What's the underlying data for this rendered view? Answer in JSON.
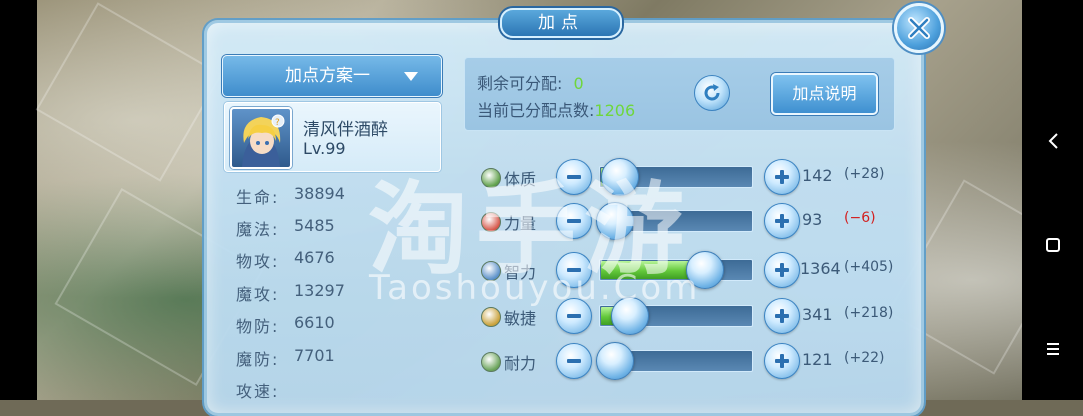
{
  "dialog": {
    "title": "加点",
    "scheme_label": "加点方案一",
    "explain_label": "加点说明"
  },
  "character": {
    "name": "清风伴酒醉",
    "level": "Lv.99"
  },
  "stats": [
    {
      "label": "生命:",
      "value": "38894"
    },
    {
      "label": "魔法:",
      "value": "5485"
    },
    {
      "label": "物攻:",
      "value": "4676"
    },
    {
      "label": "魔攻:",
      "value": "13297"
    },
    {
      "label": "物防:",
      "value": "6610"
    },
    {
      "label": "魔防:",
      "value": "7701"
    },
    {
      "label": "攻速:",
      "value": ""
    }
  ],
  "points": {
    "remaining_label": "剩余可分配:",
    "remaining_value": "0",
    "allocated_label": "当前已分配点数:",
    "allocated_value": "1206"
  },
  "attributes": [
    {
      "name": "体质",
      "value": "142",
      "bonus": "(+28)",
      "fill": 0.03,
      "icon": "constitution-icon",
      "icon_color": "#5fa04a"
    },
    {
      "name": "力量",
      "value": "93",
      "bonus": "(−6)",
      "fill": 0.0,
      "icon": "strength-icon",
      "icon_color": "#d6574a"
    },
    {
      "name": "智力",
      "value": "1364",
      "bonus": "(+405)",
      "fill": 0.6,
      "icon": "intellect-icon",
      "icon_color": "#5a90c9"
    },
    {
      "name": "敏捷",
      "value": "341",
      "bonus": "(+218)",
      "fill": 0.1,
      "icon": "agility-icon",
      "icon_color": "#c9a13a"
    },
    {
      "name": "耐力",
      "value": "121",
      "bonus": "(+22)",
      "fill": 0.0,
      "icon": "endurance-icon",
      "icon_color": "#6aa35a"
    }
  ],
  "watermark": {
    "text": "淘手游",
    "url": "Taoshouyou.Com"
  },
  "colors": {
    "positive_number": "#6fd63c",
    "negative_bonus": "#d31f1f",
    "panel_bg": "#c2e0f3"
  }
}
